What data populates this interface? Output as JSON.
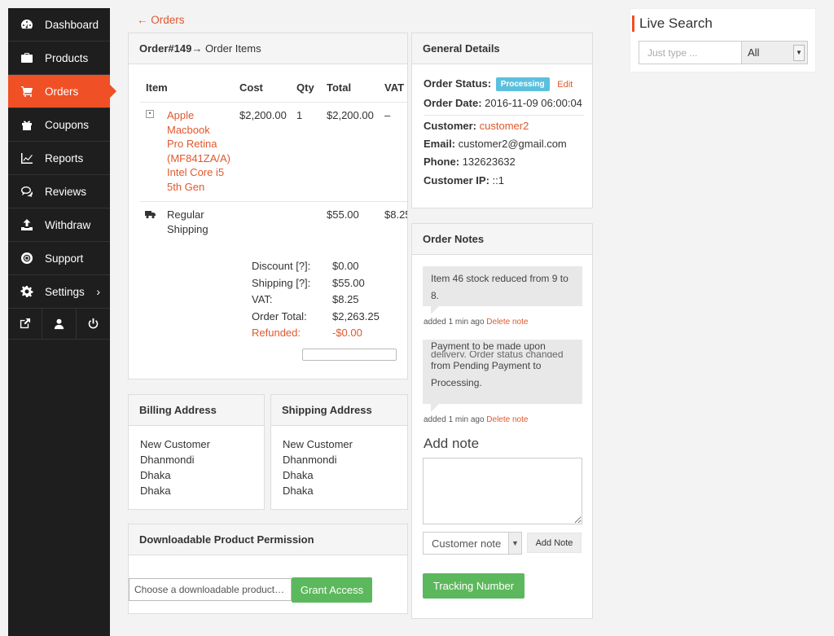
{
  "sidebar": {
    "items": [
      {
        "label": "Dashboard",
        "icon": "dashboard-icon"
      },
      {
        "label": "Products",
        "icon": "briefcase-icon"
      },
      {
        "label": "Orders",
        "icon": "cart-icon",
        "active": true
      },
      {
        "label": "Coupons",
        "icon": "gift-icon"
      },
      {
        "label": "Reports",
        "icon": "chart-icon"
      },
      {
        "label": "Reviews",
        "icon": "comments-icon"
      },
      {
        "label": "Withdraw",
        "icon": "upload-icon"
      },
      {
        "label": "Support",
        "icon": "lifebuoy-icon"
      },
      {
        "label": "Settings",
        "icon": "gear-icon"
      }
    ],
    "bottom_icons": [
      "external-link-icon",
      "user-icon",
      "power-icon"
    ]
  },
  "back_link": "← Orders",
  "order_items": {
    "title_bold": "Order#149",
    "title_rest": " → Order Items",
    "headers": {
      "item": "Item",
      "cost": "Cost",
      "qty": "Qty",
      "total": "Total",
      "vat": "VAT"
    },
    "product": {
      "name_lines": [
        "Apple",
        "Macbook",
        "Pro Retina",
        "(MF841ZA/A)",
        "Intel Core i5",
        "5th Gen"
      ],
      "cost": "$2,200.00",
      "qty": "1",
      "total": "$2,200.00",
      "vat": "–"
    },
    "shipping": {
      "name_lines": [
        "Regular",
        "Shipping"
      ],
      "total": "$55.00",
      "vat": "$8.25"
    },
    "totals": [
      {
        "label": "Discount [?]:",
        "value": "$0.00"
      },
      {
        "label": "Shipping [?]:",
        "value": "$55.00"
      },
      {
        "label": "VAT:",
        "value": "$8.25"
      },
      {
        "label": "Order Total:",
        "value": "$2,263.25"
      },
      {
        "label": "Refunded:",
        "value": "-$0.00"
      }
    ]
  },
  "general": {
    "title": "General Details",
    "status_label": "Order Status:",
    "status_value": "Processing",
    "edit": "Edit",
    "date_label": "Order Date:",
    "date_value": "2016-11-09 06:00:04",
    "customer_label": "Customer:",
    "customer_value": "customer2",
    "email_label": "Email:",
    "email_value": "customer2@gmail.com",
    "phone_label": "Phone:",
    "phone_value": "132623632",
    "ip_label": "Customer IP:",
    "ip_value": "::1"
  },
  "notes": {
    "title": "Order Notes",
    "list": [
      {
        "text_lines": [
          "Item 46 stock reduced from 9 to",
          "8."
        ],
        "meta": "added 1 min ago",
        "delete": "Delete note"
      },
      {
        "text_lines": [
          "Payment to be made upon",
          "delivery. Order status changed",
          "from Pending Payment to",
          "Processing."
        ],
        "meta": "added 1 min ago",
        "delete": "Delete note"
      }
    ],
    "add_heading": "Add note",
    "type_select": "Customer note",
    "add_button": "Add Note",
    "tracking_button": "Tracking Number"
  },
  "billing": {
    "title": "Billing Address",
    "lines": [
      "New Customer",
      "Dhanmondi",
      "Dhaka",
      "Dhaka"
    ]
  },
  "shipping_address": {
    "title": "Shipping Address",
    "lines": [
      "New Customer",
      "Dhanmondi",
      "Dhaka",
      "Dhaka"
    ]
  },
  "download": {
    "title": "Downloadable Product Permission",
    "placeholder": "Choose a downloadable product…",
    "grant": "Grant Access"
  },
  "live_search": {
    "title": "Live Search",
    "placeholder": "Just type ...",
    "select": "All"
  },
  "colors": {
    "accent": "#f05025",
    "link": "#e0582d",
    "success": "#5cb85c",
    "info": "#5bc0de",
    "sidebar": "#1e1e1e"
  }
}
